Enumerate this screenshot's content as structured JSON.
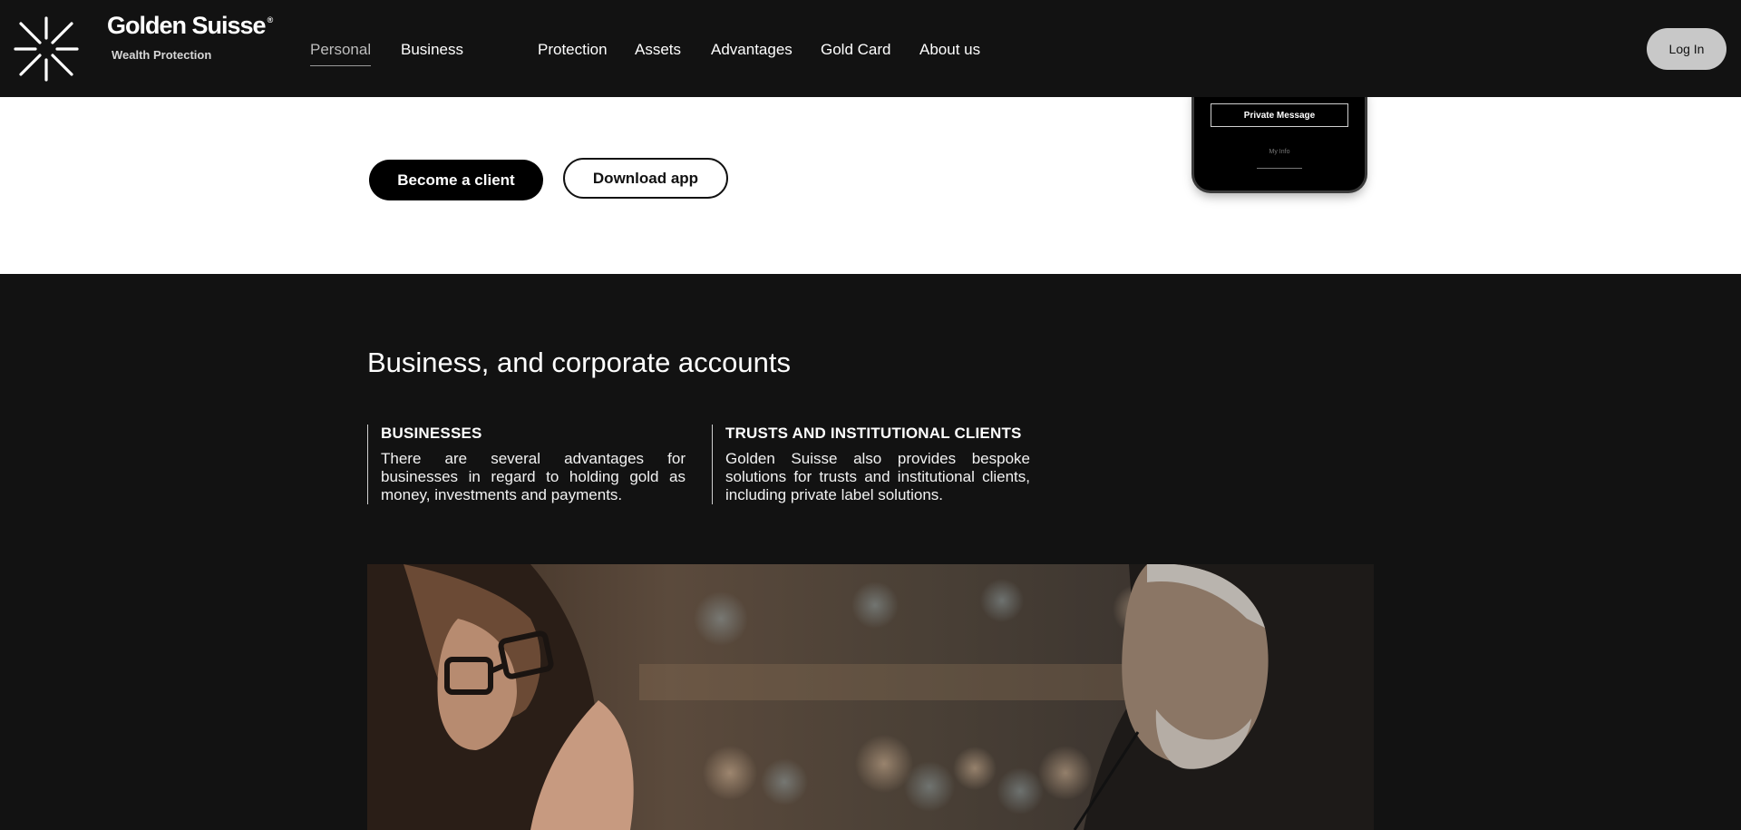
{
  "brand": {
    "name": "Golden Suisse",
    "reg": "®",
    "tagline": "Wealth Protection"
  },
  "nav": {
    "personal": "Personal",
    "business": "Business",
    "items": [
      "Protection",
      "Assets",
      "Advantages",
      "Gold Card",
      "About us"
    ],
    "login": "Log In"
  },
  "hero": {
    "become_client": "Become a client",
    "download_app": "Download app",
    "phone": {
      "private_message": "Private Message",
      "my_info": "My Info"
    }
  },
  "business": {
    "title": "Business, and corporate accounts",
    "columns": [
      {
        "heading": "BUSINESSES",
        "body": "There are several advantages for businesses in regard to holding gold as money, investments and payments."
      },
      {
        "heading": "TRUSTS AND INSTITUTIONAL CLIENTS",
        "body": "Golden Suisse also provides bespoke solutions for trusts and institutional clients, including private label solutions."
      }
    ]
  },
  "colors": {
    "header_bg": "#121212",
    "section_bg": "#121212",
    "hero_bg": "#ffffff",
    "login_bg": "#c8c8c8"
  }
}
